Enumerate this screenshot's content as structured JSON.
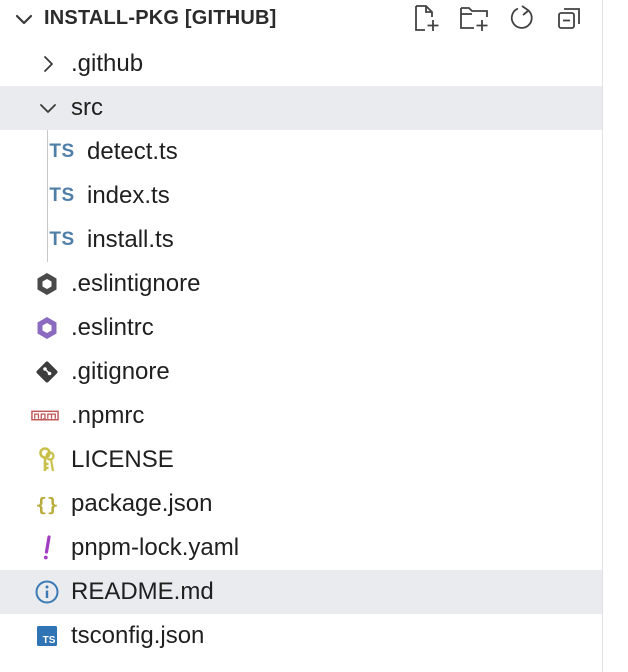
{
  "explorer": {
    "title": "INSTALL-PKG [GITHUB]",
    "actions": [
      {
        "name": "new-file-icon"
      },
      {
        "name": "new-folder-icon"
      },
      {
        "name": "refresh-icon"
      },
      {
        "name": "collapse-all-icon"
      }
    ],
    "items": [
      {
        "label": ".github",
        "type": "folder",
        "state": "collapsed"
      },
      {
        "label": "src",
        "type": "folder",
        "state": "expanded"
      },
      {
        "label": "detect.ts",
        "type": "file",
        "icon": "typescript-icon"
      },
      {
        "label": "index.ts",
        "type": "file",
        "icon": "typescript-icon"
      },
      {
        "label": "install.ts",
        "type": "file",
        "icon": "typescript-icon"
      },
      {
        "label": ".eslintignore",
        "type": "file",
        "icon": "eslint-ignore-icon"
      },
      {
        "label": ".eslintrc",
        "type": "file",
        "icon": "eslint-icon"
      },
      {
        "label": ".gitignore",
        "type": "file",
        "icon": "git-icon"
      },
      {
        "label": ".npmrc",
        "type": "file",
        "icon": "npm-icon"
      },
      {
        "label": "LICENSE",
        "type": "file",
        "icon": "license-key-icon"
      },
      {
        "label": "package.json",
        "type": "file",
        "icon": "json-braces-icon"
      },
      {
        "label": "pnpm-lock.yaml",
        "type": "file",
        "icon": "yaml-exclamation-icon"
      },
      {
        "label": "README.md",
        "type": "file",
        "icon": "info-icon"
      },
      {
        "label": "tsconfig.json",
        "type": "file",
        "icon": "tsconfig-icon"
      }
    ],
    "ts_badge": "TS",
    "colors": {
      "highlight": "#e9ebee",
      "ts_blue": "#4f7fa6",
      "eslint_purple": "#8b6bbf",
      "npm_red": "#c05a5a",
      "license_yellow": "#c9c04a",
      "json_yellow": "#b7ab3a",
      "yaml_purple": "#a23dc2",
      "info_blue": "#3b7bb5"
    }
  }
}
